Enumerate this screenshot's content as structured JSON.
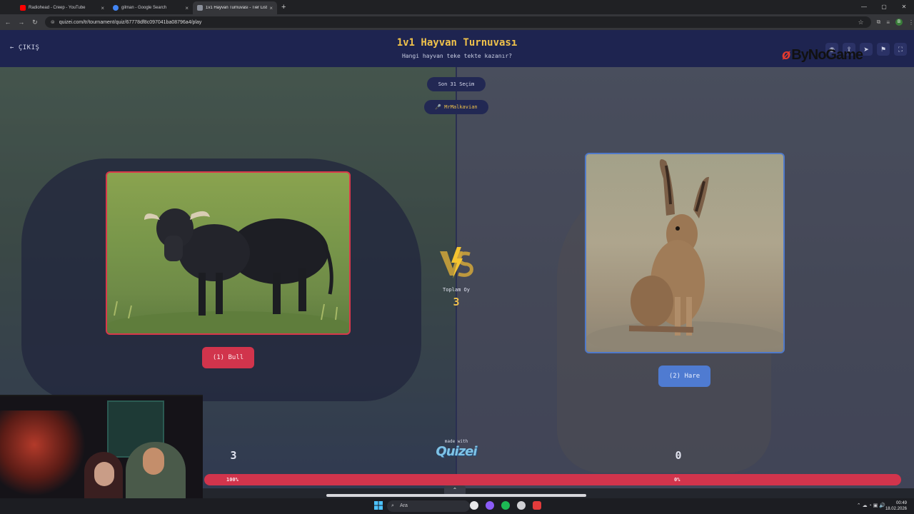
{
  "browser": {
    "tabs": [
      {
        "label": "Radiohead - Creep - YouTube",
        "color": "#ff0000"
      },
      {
        "label": "gilman - Google Search",
        "color": "#4285f4"
      },
      {
        "label": "1v1 Hayvan Turnuvası - Tier List",
        "color": "#8a8f9a"
      }
    ],
    "new_tab": "+",
    "url": "quizei.com/tr/tournament/quiz/67778df8c097041ba08796a4/play"
  },
  "header": {
    "exit_label": "← ÇIKIŞ",
    "title": "1v1 Hayvan Turnuvası",
    "subtitle": "Hangi hayvan teke tekte kazanır?"
  },
  "watermark": "ByNoGame",
  "badges": {
    "round": "Son 31 Seçim",
    "user": "🎤 MrMalkavian"
  },
  "left": {
    "button_label": "(1) Bull",
    "votes": "3",
    "percent": "100%",
    "accent": "#d1344c"
  },
  "right": {
    "button_label": "(2) Hare",
    "votes": "0",
    "percent": "0%",
    "accent": "#4f7bd1"
  },
  "center": {
    "vs": "VS",
    "total_label": "Toplam Oy",
    "total_value": "3"
  },
  "footer": {
    "made_with": "made with",
    "brand": "Quizei"
  },
  "taskbar": {
    "search_placeholder": "Ara",
    "time": "00:49",
    "date": "18.02.2026"
  }
}
